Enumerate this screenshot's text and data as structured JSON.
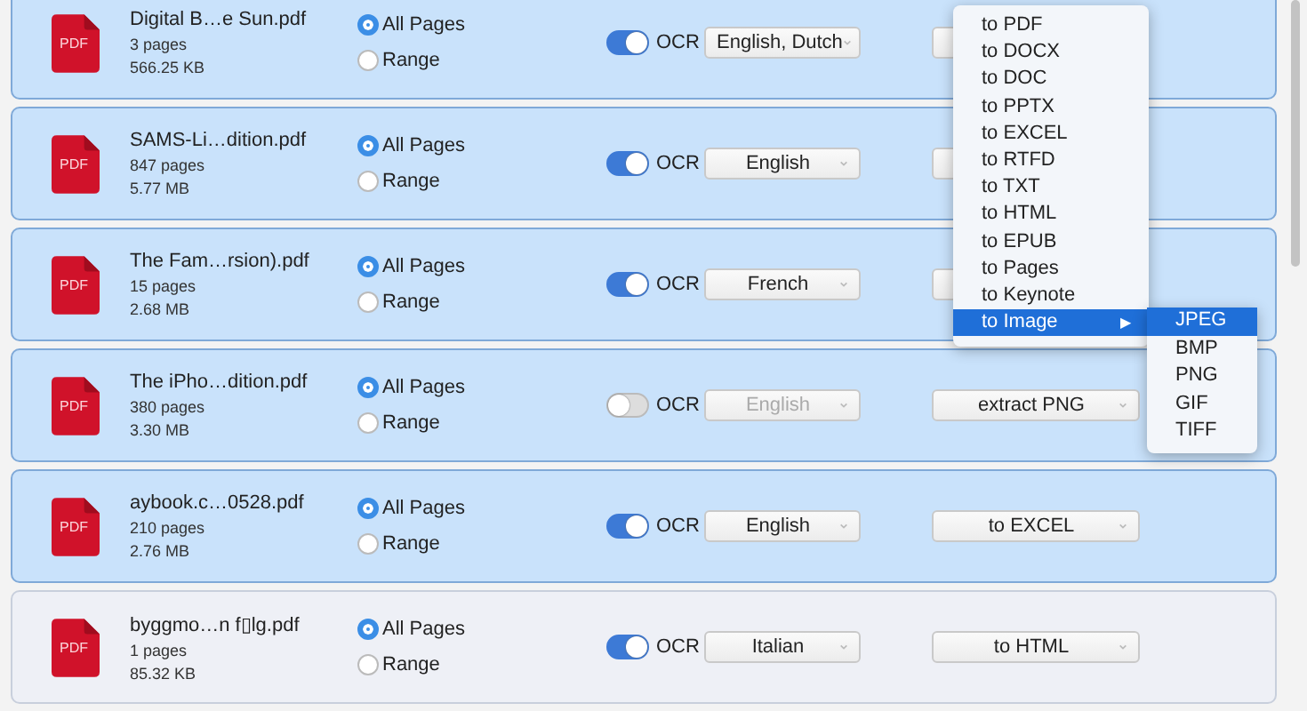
{
  "files": [
    {
      "type_label": "PDF",
      "name": "Digital B…e Sun.pdf",
      "pages": "3 pages",
      "size": "566.25 KB",
      "selected": true,
      "page_options": [
        {
          "label": "All Pages",
          "selected": true
        },
        {
          "label": "Range",
          "selected": false
        }
      ],
      "ocr": {
        "label": "OCR",
        "on": true
      },
      "language": {
        "value": "English, Dutch",
        "disabled": false
      }
    },
    {
      "type_label": "PDF",
      "name": "SAMS-Li…dition.pdf",
      "pages": "847 pages",
      "size": "5.77 MB",
      "selected": true,
      "page_options": [
        {
          "label": "All Pages",
          "selected": true
        },
        {
          "label": "Range",
          "selected": false
        }
      ],
      "ocr": {
        "label": "OCR",
        "on": true
      },
      "language": {
        "value": "English",
        "disabled": false
      }
    },
    {
      "type_label": "PDF",
      "name": "The Fam…rsion).pdf",
      "pages": "15 pages",
      "size": "2.68 MB",
      "selected": true,
      "page_options": [
        {
          "label": "All Pages",
          "selected": true
        },
        {
          "label": "Range",
          "selected": false
        }
      ],
      "ocr": {
        "label": "OCR",
        "on": true
      },
      "language": {
        "value": "French",
        "disabled": false
      }
    },
    {
      "type_label": "PDF",
      "name": "The iPho…dition.pdf",
      "pages": "380 pages",
      "size": "3.30 MB",
      "selected": true,
      "page_options": [
        {
          "label": "All Pages",
          "selected": true
        },
        {
          "label": "Range",
          "selected": false
        }
      ],
      "ocr": {
        "label": "OCR",
        "on": false
      },
      "language": {
        "value": "English",
        "disabled": true
      },
      "convert": "extract PNG"
    },
    {
      "type_label": "PDF",
      "name": "aybook.c…0528.pdf",
      "pages": "210 pages",
      "size": "2.76 MB",
      "selected": true,
      "page_options": [
        {
          "label": "All Pages",
          "selected": true
        },
        {
          "label": "Range",
          "selected": false
        }
      ],
      "ocr": {
        "label": "OCR",
        "on": true
      },
      "language": {
        "value": "English",
        "disabled": false
      },
      "convert": "to EXCEL"
    },
    {
      "type_label": "PDF",
      "name": "byggmo…n f▯lg.pdf",
      "pages": "1 pages",
      "size": "85.32 KB",
      "selected": false,
      "page_options": [
        {
          "label": "All Pages",
          "selected": true
        },
        {
          "label": "Range",
          "selected": false
        }
      ],
      "ocr": {
        "label": "OCR",
        "on": true
      },
      "language": {
        "value": "Italian",
        "disabled": false
      },
      "convert": "to HTML"
    }
  ],
  "format_menu": {
    "items": [
      {
        "label": "to PDF",
        "selected": false
      },
      {
        "label": "to DOCX",
        "selected": false
      },
      {
        "label": "to DOC",
        "selected": false
      },
      {
        "label": "to PPTX",
        "selected": false
      },
      {
        "label": "to EXCEL",
        "selected": false
      },
      {
        "label": "to RTFD",
        "selected": false
      },
      {
        "label": "to TXT",
        "selected": false
      },
      {
        "label": "to HTML",
        "selected": false
      },
      {
        "label": "to EPUB",
        "selected": false
      },
      {
        "label": "to Pages",
        "selected": false
      },
      {
        "label": "to Keynote",
        "selected": false
      },
      {
        "label": "to Image",
        "selected": true,
        "arrow": "▶"
      }
    ],
    "submenu": [
      {
        "label": "JPEG",
        "selected": true
      },
      {
        "label": "BMP",
        "selected": false
      },
      {
        "label": "PNG",
        "selected": false
      },
      {
        "label": "GIF",
        "selected": false
      },
      {
        "label": "TIFF",
        "selected": false
      }
    ]
  }
}
